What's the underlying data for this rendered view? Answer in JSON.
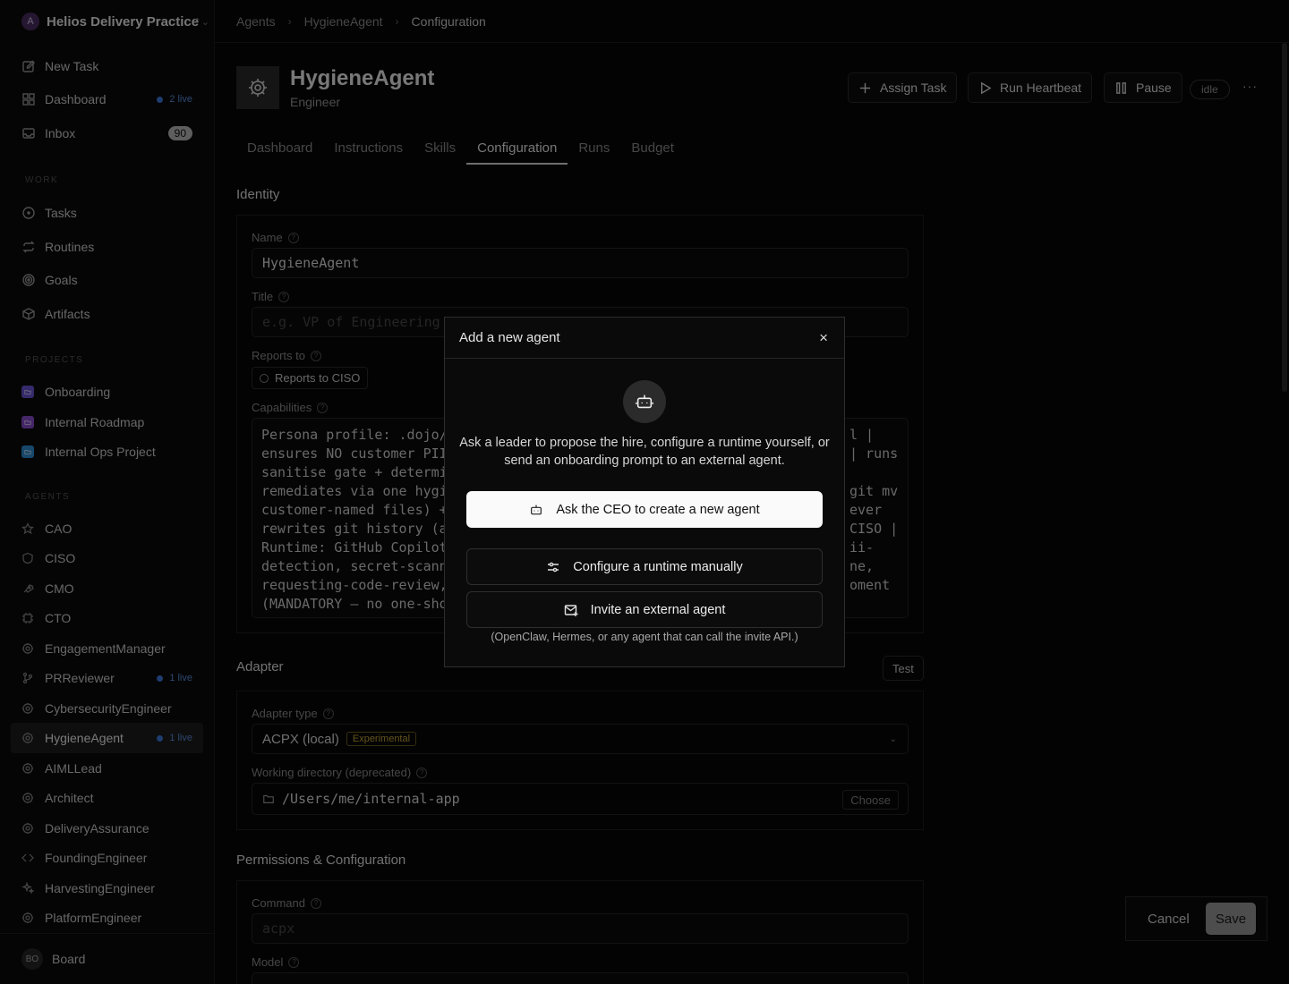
{
  "workspace": {
    "avatar": "A",
    "name": "Helios Delivery Practice"
  },
  "nav": {
    "new_task": "New Task",
    "dashboard": "Dashboard",
    "dashboard_live": "2 live",
    "inbox": "Inbox",
    "inbox_count": "90"
  },
  "sections": {
    "work": "WORK",
    "projects": "PROJECTS",
    "agents": "AGENTS"
  },
  "work_items": [
    {
      "label": "Tasks"
    },
    {
      "label": "Routines"
    },
    {
      "label": "Goals"
    },
    {
      "label": "Artifacts"
    }
  ],
  "projects": [
    {
      "label": "Onboarding",
      "color": "#6b55d6"
    },
    {
      "label": "Internal Roadmap",
      "color": "#8a4fd0"
    },
    {
      "label": "Internal Ops Project",
      "color": "#2f8fd6"
    }
  ],
  "agents": [
    {
      "label": "CAO",
      "icon": "star-icon"
    },
    {
      "label": "CISO",
      "icon": "shield-icon"
    },
    {
      "label": "CMO",
      "icon": "rocket-icon"
    },
    {
      "label": "CTO",
      "icon": "cpu-icon"
    },
    {
      "label": "EngagementManager",
      "icon": "gear-icon"
    },
    {
      "label": "PRReviewer",
      "icon": "git-branch-icon",
      "live": "1 live"
    },
    {
      "label": "CybersecurityEngineer",
      "icon": "gear-icon"
    },
    {
      "label": "HygieneAgent",
      "icon": "gear-icon",
      "live": "1 live"
    },
    {
      "label": "AIMLLead",
      "icon": "gear-icon"
    },
    {
      "label": "Architect",
      "icon": "gear-icon"
    },
    {
      "label": "DeliveryAssurance",
      "icon": "gear-icon"
    },
    {
      "label": "FoundingEngineer",
      "icon": "code-icon"
    },
    {
      "label": "HarvestingEngineer",
      "icon": "sparkles-icon"
    },
    {
      "label": "PlatformEngineer",
      "icon": "gear-icon"
    }
  ],
  "user": {
    "initials": "BO",
    "name": "Board"
  },
  "breadcrumb": [
    "Agents",
    "HygieneAgent",
    "Configuration"
  ],
  "agent": {
    "name": "HygieneAgent",
    "role": "Engineer",
    "status": "idle"
  },
  "actions": {
    "assign": "Assign Task",
    "heartbeat": "Run Heartbeat",
    "pause": "Pause",
    "more": "···"
  },
  "tabs": [
    "Dashboard",
    "Instructions",
    "Skills",
    "Configuration",
    "Runs",
    "Budget"
  ],
  "identity": {
    "heading": "Identity",
    "name_label": "Name",
    "name_value": "HygieneAgent",
    "title_label": "Title",
    "title_placeholder": "e.g. VP of Engineering",
    "reports_label": "Reports to",
    "reports_value": "Reports to CISO",
    "capabilities_label": "Capabilities",
    "capabilities_left": [
      "Persona profile: .dojo/a",
      "ensures NO customer PII",
      "sanitise gate + determin",
      "remediates via one hygie",
      "customer-named files) +",
      "rewrites git history (ad",
      "Runtime: GitHub Copilot",
      "detection, secret-scanni",
      "requesting-code-review, ",
      "(MANDATORY — no one-shot"
    ],
    "capabilities_right": [
      "l |",
      "| runs",
      "",
      "git mv",
      "ever",
      "CISO |",
      "ii-",
      "ne,",
      "oment",
      ""
    ]
  },
  "adapter": {
    "heading": "Adapter",
    "test": "Test",
    "type_label": "Adapter type",
    "type_value": "ACPX (local)",
    "type_badge": "Experimental",
    "dir_label": "Working directory (deprecated)",
    "dir_value": "/Users/me/internal-app",
    "choose": "Choose"
  },
  "permissions": {
    "heading": "Permissions & Configuration",
    "command_label": "Command",
    "command_placeholder": "acpx",
    "model_label": "Model"
  },
  "footer": {
    "cancel": "Cancel",
    "save": "Save"
  },
  "modal": {
    "title": "Add a new agent",
    "close": "×",
    "description": "Ask a leader to propose the hire, configure a runtime yourself, or send an onboarding prompt to an external agent.",
    "ask_ceo": "Ask the CEO to create a new agent",
    "configure_runtime": "Configure a runtime manually",
    "invite_external": "Invite an external agent",
    "note": "(OpenClaw, Hermes, or any agent that can call the invite API.)"
  }
}
